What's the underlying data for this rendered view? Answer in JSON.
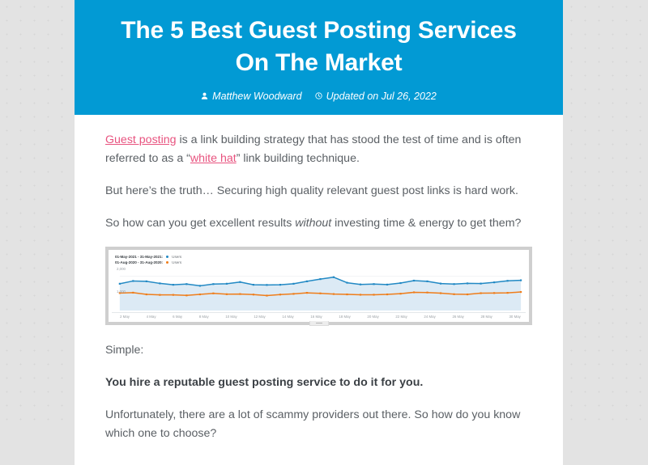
{
  "colors": {
    "header_blue": "#029ad4",
    "link_pink": "#e8537f",
    "body_text": "#5b6065",
    "series_blue": "#2289c4",
    "series_orange": "#ef7d1a",
    "page_background": "#e3e3e3"
  },
  "header": {
    "title": "The 5 Best Guest Posting Services On The Market",
    "author_icon": "person-icon",
    "author": "Matthew Woodward",
    "date_icon": "clock-icon",
    "updated": "Updated on Jul 26, 2022"
  },
  "body": {
    "p1_link1": "Guest posting",
    "p1_part1": " is a link building strategy that has stood the test of time and is often referred to as a “",
    "p1_link2": "white hat",
    "p1_part2": "” link building technique.",
    "p2": "But here’s the truth… Securing high quality relevant guest post links is hard work.",
    "p3_part1": "So how can you get excellent results ",
    "p3_em": "without",
    "p3_part2": " investing time & energy to get them?",
    "p4": "Simple:",
    "p5_bold": "You hire a reputable guest posting service to do it for you.",
    "p6": "Unfortunately, there are a lot of scammy providers out there. So how do you know which one to choose?"
  },
  "chart_data": {
    "type": "line",
    "title": "",
    "xlabel": "",
    "ylabel": "",
    "ylim": [
      0,
      2400
    ],
    "grid": true,
    "legend_position": "top-left",
    "y_ticks": [
      "2,000",
      "1,000"
    ],
    "x": [
      1,
      2,
      3,
      4,
      5,
      6,
      7,
      8,
      9,
      10,
      11,
      12,
      13,
      14,
      15,
      16,
      17,
      18,
      19,
      20,
      21,
      22,
      23,
      24,
      25,
      26,
      27,
      28,
      29,
      30,
      31
    ],
    "categories": [
      "2 May",
      "4 May",
      "6 May",
      "8 May",
      "10 May",
      "12 May",
      "14 May",
      "16 May",
      "18 May",
      "20 May",
      "22 May",
      "24 May",
      "26 May",
      "28 May",
      "30 May"
    ],
    "series": [
      {
        "name": "Users",
        "range": "01-May-2021 - 31-May-2021:",
        "color": "#2289c4",
        "values": [
          1560,
          1720,
          1700,
          1580,
          1500,
          1540,
          1440,
          1540,
          1560,
          1660,
          1500,
          1490,
          1500,
          1560,
          1700,
          1830,
          1940,
          1620,
          1520,
          1540,
          1510,
          1600,
          1740,
          1700,
          1570,
          1540,
          1580,
          1570,
          1640,
          1730,
          1760
        ]
      },
      {
        "name": "Users",
        "range": "01-Aug-2020 - 31-Aug-2020:",
        "color": "#ef7d1a",
        "values": [
          1020,
          1040,
          940,
          910,
          910,
          880,
          940,
          1000,
          950,
          960,
          930,
          870,
          930,
          970,
          1030,
          1000,
          960,
          940,
          920,
          920,
          940,
          980,
          1060,
          1050,
          1010,
          950,
          940,
          1010,
          1020,
          1030,
          1080
        ]
      }
    ],
    "handle": "chart-resize-handle"
  }
}
